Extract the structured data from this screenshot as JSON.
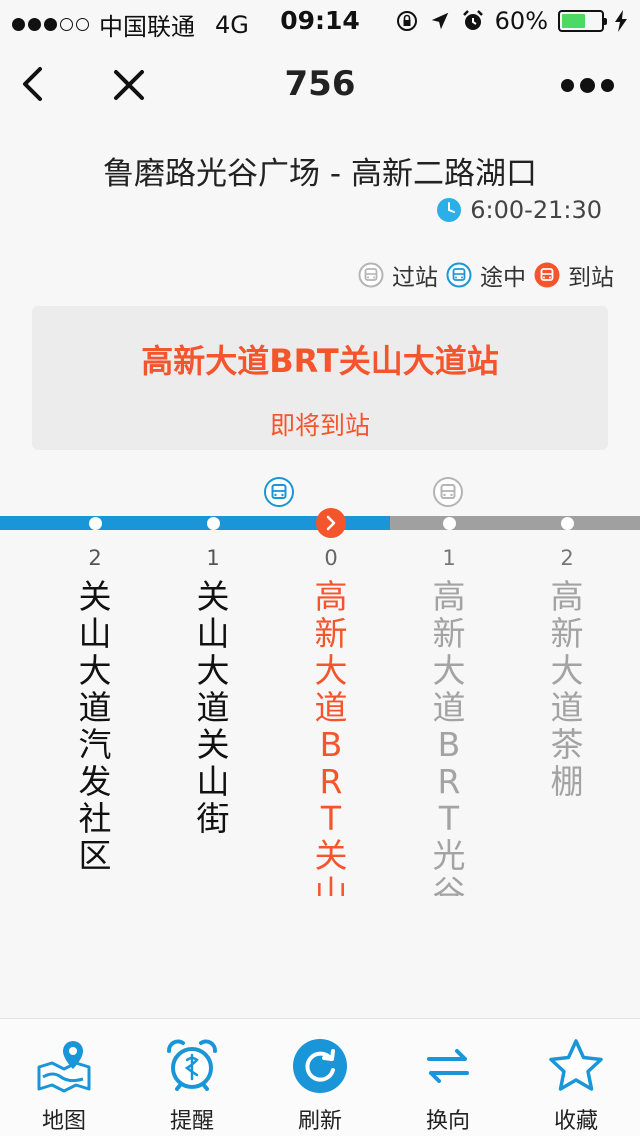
{
  "status_bar": {
    "carrier": "中国联通",
    "network": "4G",
    "time": "09:14",
    "battery": "60%",
    "battery_level": 0.6
  },
  "nav": {
    "title": "756"
  },
  "route": {
    "name": "鲁磨路光谷广场 - 高新二路湖口",
    "hours": "6:00-21:30"
  },
  "legend": {
    "passed": "过站",
    "enroute": "途中",
    "arrived": "到站"
  },
  "card": {
    "station": "高新大道BRT关山大道站",
    "status": "即将到站"
  },
  "stops": [
    {
      "num": "2",
      "name": "关山大道汽发社区"
    },
    {
      "num": "1",
      "name": "关山大道关山街"
    },
    {
      "num": "0",
      "name": "高新大道BRT关山大道站"
    },
    {
      "num": "1",
      "name": "高新大道BRT光谷大道站"
    },
    {
      "num": "2",
      "name": "高新大道茶棚"
    }
  ],
  "tabs": {
    "map": "地图",
    "remind": "提醒",
    "refresh": "刷新",
    "reverse": "换向",
    "favorite": "收藏"
  },
  "colors": {
    "accent_blue": "#1a96d8",
    "highlight_red": "#f4552d",
    "track_gray": "#a0a0a0"
  }
}
